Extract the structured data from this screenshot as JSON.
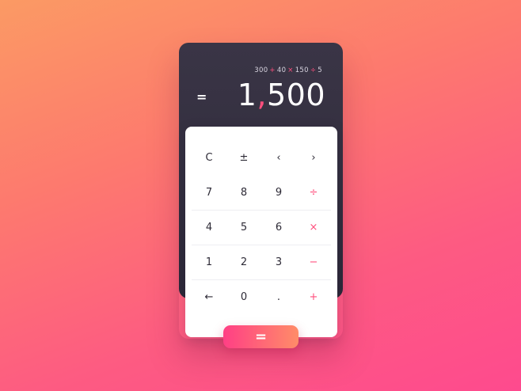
{
  "display": {
    "expression": [
      "300",
      "+",
      "40",
      "×",
      "150",
      "÷",
      "5"
    ],
    "equals_symbol": "=",
    "result_before": "1",
    "result_comma": ",",
    "result_after": "500"
  },
  "keypad": {
    "rows": [
      [
        {
          "label": "C",
          "type": "fn"
        },
        {
          "label": "±",
          "type": "fn"
        },
        {
          "label": "‹",
          "type": "fn"
        },
        {
          "label": "›",
          "type": "fn"
        }
      ],
      [
        {
          "label": "7",
          "type": "num"
        },
        {
          "label": "8",
          "type": "num"
        },
        {
          "label": "9",
          "type": "num"
        },
        {
          "label": "÷",
          "type": "op"
        }
      ],
      [
        {
          "label": "4",
          "type": "num"
        },
        {
          "label": "5",
          "type": "num"
        },
        {
          "label": "6",
          "type": "num"
        },
        {
          "label": "×",
          "type": "op"
        }
      ],
      [
        {
          "label": "1",
          "type": "num"
        },
        {
          "label": "2",
          "type": "num"
        },
        {
          "label": "3",
          "type": "num"
        },
        {
          "label": "−",
          "type": "op"
        }
      ],
      [
        {
          "label": "←",
          "type": "fn"
        },
        {
          "label": "0",
          "type": "num"
        },
        {
          "label": ".",
          "type": "num"
        },
        {
          "label": "+",
          "type": "op"
        }
      ]
    ],
    "equals_label": "="
  },
  "colors": {
    "accent": "#ff4f7d",
    "display_bg": "#2f2b3c",
    "keypad_bg": "#ffffff"
  }
}
